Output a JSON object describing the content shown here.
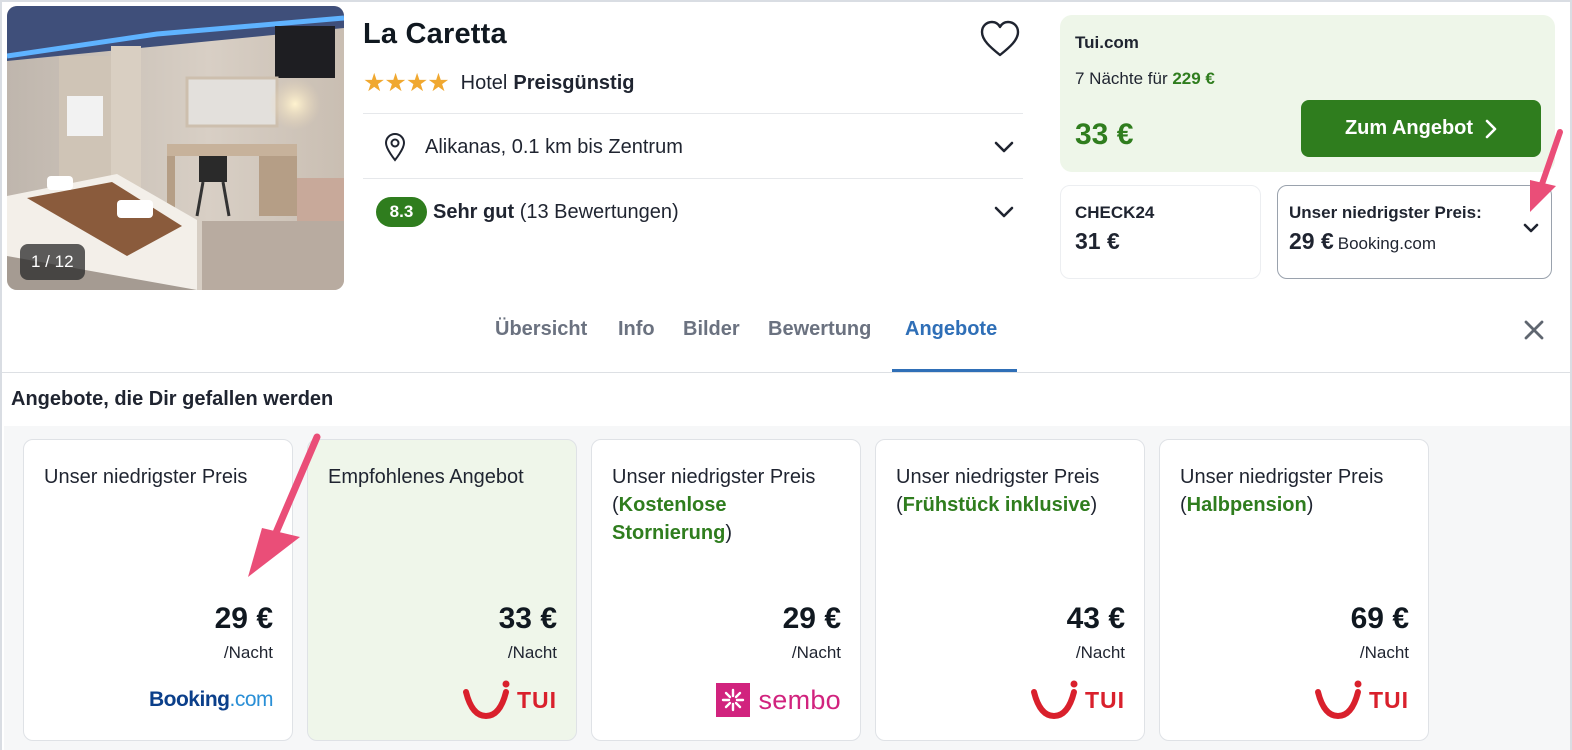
{
  "hotel": {
    "name": "La Caretta",
    "stars": "★★★★",
    "category": "Hotel",
    "price_class": "Preisgünstig",
    "photo_counter": "1 / 12",
    "location": "Alikanas, 0.1 km bis Zentrum",
    "score": "8.3",
    "rating_label": "Sehr gut",
    "rating_count": "(13 Bewertungen)"
  },
  "main_offer": {
    "provider": "Tui.com",
    "nights_text": "7 Nächte für",
    "total_price": "229 €",
    "price_per_night": "33 €",
    "cta_label": "Zum Angebot"
  },
  "alt_offers": {
    "check24_name": "CHECK24",
    "check24_price": "31 €",
    "lowest_label": "Unser niedrigster Preis:",
    "lowest_price": "29 €",
    "lowest_provider": "Booking.com"
  },
  "tabs": [
    {
      "label": "Übersicht"
    },
    {
      "label": "Info"
    },
    {
      "label": "Bilder"
    },
    {
      "label": "Bewertung"
    },
    {
      "label": "Angebote"
    }
  ],
  "offers_section": {
    "title": "Angebote, die Dir gefallen werden"
  },
  "cards": [
    {
      "title": "Unser niedrigster Preis",
      "prefix": "",
      "highlight": "",
      "suffix": "",
      "price": "29 €",
      "unit": "/Nacht",
      "provider_logo": "Booking.com"
    },
    {
      "title": "Empfohlenes Angebot",
      "prefix": "",
      "highlight": "",
      "suffix": "",
      "price": "33 €",
      "unit": "/Nacht",
      "provider_logo": "TUI"
    },
    {
      "title": "Unser niedrigster Preis",
      "prefix": "(",
      "highlight": "Kostenlose Stornierung",
      "suffix": ")",
      "price": "29 €",
      "unit": "/Nacht",
      "provider_logo": "sembo"
    },
    {
      "title": "Unser niedrigster Preis",
      "prefix": "(",
      "highlight": "Frühstück inklusive",
      "suffix": ")",
      "price": "43 €",
      "unit": "/Nacht",
      "provider_logo": "TUI"
    },
    {
      "title": "Unser niedrigster Preis",
      "prefix": "(",
      "highlight": "Halbpension",
      "suffix": ")",
      "price": "69 €",
      "unit": "/Nacht",
      "provider_logo": "TUI"
    }
  ],
  "logos": {
    "booking_part1": "Booking",
    "booking_part2": ".com",
    "tui": "TUI",
    "sembo": "sembo"
  },
  "colors": {
    "accent_green": "#2f7d1e",
    "tab_active": "#2f6fb7",
    "annotation_arrow": "#ea4e78",
    "tui_red": "#d9202c",
    "sembo_pink": "#d1237e"
  },
  "icons": [
    "heart-icon",
    "location-pin-icon",
    "chevron-down-icon",
    "chevron-right-icon",
    "close-icon",
    "star-icon"
  ]
}
